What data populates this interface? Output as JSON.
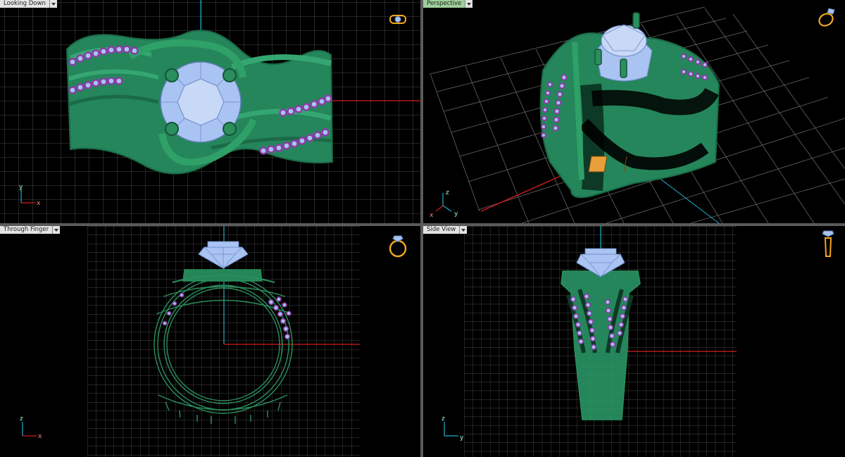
{
  "viewports": [
    {
      "id": "top",
      "title": "Looking Down",
      "active": false,
      "axes": [
        "y",
        "x"
      ]
    },
    {
      "id": "persp",
      "title": "Perspective",
      "active": true,
      "axes": [
        "z",
        "x",
        "y"
      ]
    },
    {
      "id": "front",
      "title": "Through Finger",
      "active": false,
      "axes": [
        "z",
        "x"
      ]
    },
    {
      "id": "side",
      "title": "Side View",
      "active": false,
      "axes": [
        "z",
        "y"
      ]
    }
  ],
  "colors": {
    "background": "#000000",
    "grid": "#5c5c5c",
    "ring_metal": "#2a8f5c",
    "stone": "#a9c3f2",
    "accent_stone": "#8e3aa8",
    "axis_x": "#d21c1c",
    "axis_y": "#1fb0c8",
    "icon": "#f2a81c",
    "active_tab": "#9ecf9a"
  },
  "icons": [
    "ring-top-icon",
    "ring-perspective-icon",
    "ring-front-icon",
    "ring-side-icon"
  ]
}
